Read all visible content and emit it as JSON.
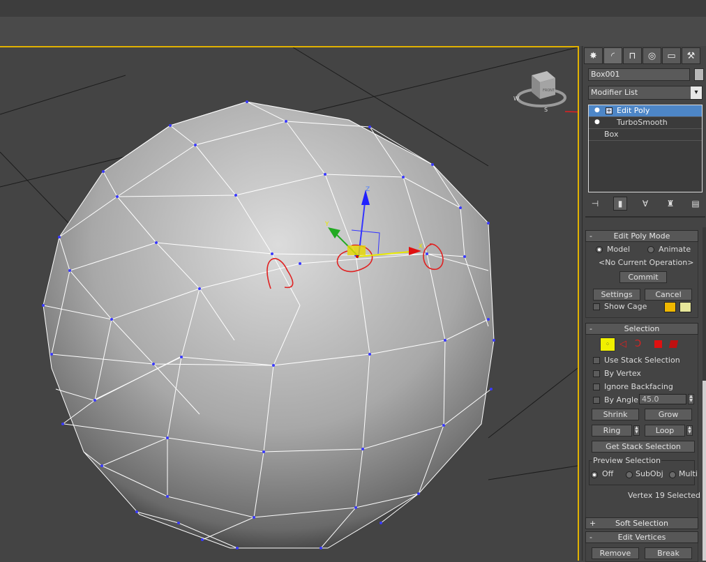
{
  "panel": {
    "tabs": [
      {
        "name": "create-tab",
        "glyph": "✸"
      },
      {
        "name": "modify-tab",
        "glyph": "◜"
      },
      {
        "name": "hierarchy-tab",
        "glyph": "⊓"
      },
      {
        "name": "motion-tab",
        "glyph": "◎"
      },
      {
        "name": "display-tab",
        "glyph": "▭"
      },
      {
        "name": "utilities-tab",
        "glyph": "⚒"
      }
    ],
    "object_name": "Box001",
    "modifier_list_label": "Modifier List",
    "stack": [
      {
        "label": "Edit Poly",
        "selected": true
      },
      {
        "label": "TurboSmooth",
        "selected": false
      },
      {
        "label": "Box",
        "selected": false
      }
    ]
  },
  "edit_poly_mode": {
    "title": "Edit Poly Mode",
    "model_label": "Model",
    "animate_label": "Animate",
    "operation_text": "<No Current Operation>",
    "commit_label": "Commit",
    "settings_label": "Settings",
    "cancel_label": "Cancel",
    "show_cage_label": "Show Cage",
    "cage_colors": [
      "#f0b800",
      "#e6e69a"
    ]
  },
  "selection": {
    "title": "Selection",
    "use_stack_label": "Use Stack Selection",
    "by_vertex_label": "By Vertex",
    "ignore_backfacing_label": "Ignore Backfacing",
    "by_angle_label": "By Angle:",
    "by_angle_value": "45.0",
    "shrink_label": "Shrink",
    "grow_label": "Grow",
    "ring_label": "Ring",
    "loop_label": "Loop",
    "get_stack_label": "Get Stack Selection",
    "preview_title": "Preview Selection",
    "off_label": "Off",
    "subobj_label": "SubObj",
    "multi_label": "Multi",
    "status": "Vertex 19 Selected"
  },
  "soft_selection": {
    "title": "Soft Selection"
  },
  "edit_vertices": {
    "title": "Edit Vertices",
    "remove_label": "Remove",
    "break_label": "Break"
  },
  "viewcube": {
    "face_label": "FRONT",
    "compass": [
      "W",
      "S"
    ]
  },
  "gizmo": {
    "axes": [
      "X",
      "Y",
      "Z"
    ]
  },
  "colors": {
    "active_viewport_border": "#e1b200",
    "selection_highlight": "#4d86c7",
    "vertex": "#3a3aff",
    "annotation": "#e02020"
  }
}
